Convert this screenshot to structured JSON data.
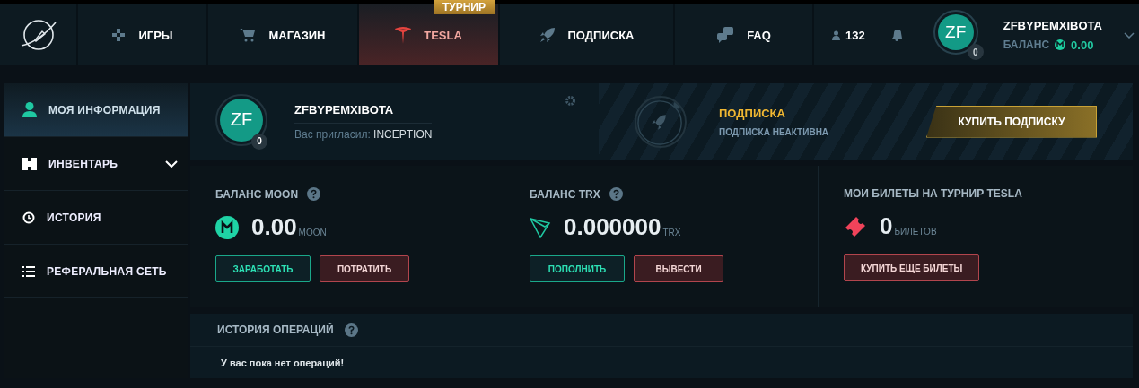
{
  "header": {
    "nav": [
      {
        "label": "ИГРЫ",
        "selected": false
      },
      {
        "label": "МАГАЗИН",
        "selected": false
      },
      {
        "label": "TESLA",
        "selected": true,
        "badge": "ТУРНИР"
      },
      {
        "label": "ПОДПИСКА",
        "selected": false
      },
      {
        "label": "FAQ",
        "selected": false
      }
    ],
    "online_count": "132",
    "user": {
      "initials": "ZF",
      "level": "0",
      "name": "ZFBYPEMXIBOTA",
      "balance_label": "БАЛАНС",
      "balance": "0.00"
    }
  },
  "sidebar": {
    "items": [
      {
        "label": "МОЯ ИНФОРМАЦИЯ",
        "selected": true,
        "kind": "link"
      },
      {
        "label": "ИНВЕНТАРЬ",
        "selected": false,
        "kind": "group"
      },
      {
        "label": "ИСТОРИЯ",
        "selected": false,
        "kind": "link"
      },
      {
        "label": "РЕФЕРАЛЬНАЯ СЕТЬ",
        "selected": false,
        "kind": "link"
      }
    ]
  },
  "profile": {
    "initials": "ZF",
    "level": "0",
    "name": "ZFBYPEMXIBOTA",
    "invited_label": "Вас пригласил:",
    "invited_by": "INCEPTION"
  },
  "subscription": {
    "title": "ПОДПИСКА",
    "status": "ПОДПИСКА НЕАКТИВНА",
    "button": "КУПИТЬ ПОДПИСКУ"
  },
  "balances": [
    {
      "kind": "moon",
      "title": "БАЛАНС MOON",
      "help": true,
      "amount": "0.00",
      "unit": "MOON",
      "buttons": [
        {
          "label": "ЗАРАБОТАТЬ",
          "kind": "primary"
        },
        {
          "label": "ПОТРАТИТЬ",
          "kind": "danger"
        }
      ]
    },
    {
      "kind": "trx",
      "title": "БАЛАНС TRX",
      "help": true,
      "amount": "0.000000",
      "unit": "TRX",
      "buttons": [
        {
          "label": "ПОПОЛНИТЬ",
          "kind": "primary"
        },
        {
          "label": "ВЫВЕСТИ",
          "kind": "danger"
        }
      ]
    },
    {
      "kind": "tickets",
      "title": "МОИ БИЛЕТЫ НА ТУРНИР TESLA",
      "help": false,
      "amount": "0",
      "unit": "БИЛЕТОВ",
      "buttons": [
        {
          "label": "КУПИТЬ ЕЩЕ БИЛЕТЫ",
          "kind": "danger"
        }
      ]
    }
  ],
  "history": {
    "title": "ИСТОРИЯ ОПЕРАЦИЙ",
    "empty_text": "У вас пока нет операций!"
  }
}
